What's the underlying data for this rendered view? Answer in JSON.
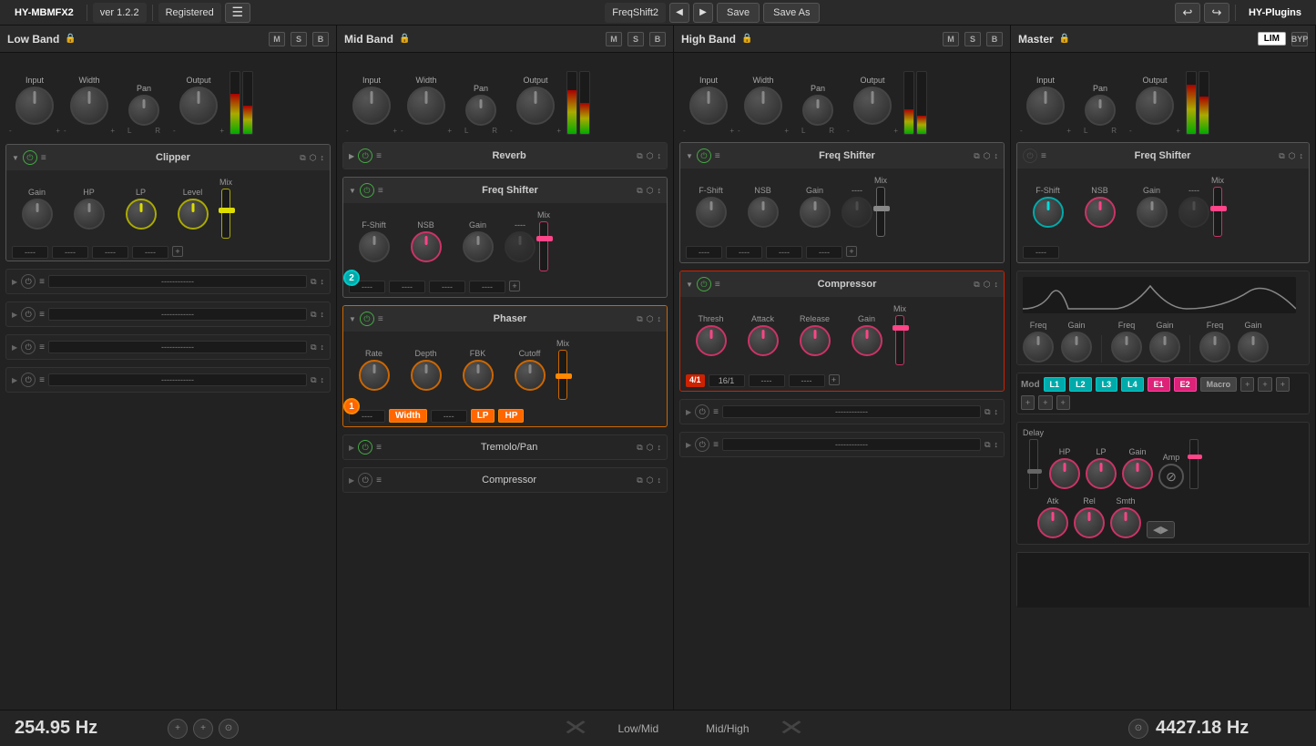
{
  "topbar": {
    "plugin_name": "HY-MBMFX2",
    "version": "ver 1.2.2",
    "registered": "Registered",
    "preset_name": "FreqShift2",
    "save_label": "Save",
    "save_as_label": "Save As",
    "brand": "HY-Plugins"
  },
  "bands": {
    "low": {
      "title": "Low Band",
      "m": "M",
      "s": "S",
      "b": "B",
      "knobs": [
        "Input",
        "Width",
        "Pan",
        "Output"
      ],
      "vu_levels": [
        65,
        45
      ]
    },
    "mid": {
      "title": "Mid Band",
      "m": "M",
      "s": "S",
      "b": "B",
      "knobs": [
        "Input",
        "Width",
        "Pan",
        "Output"
      ],
      "vu_levels": [
        70,
        50
      ]
    },
    "high": {
      "title": "High Band",
      "m": "M",
      "s": "S",
      "b": "B",
      "knobs": [
        "Input",
        "Width",
        "Pan",
        "Output"
      ],
      "vu_levels": [
        40,
        30
      ]
    },
    "master": {
      "title": "Master",
      "lim": "LIM",
      "byp": "BYP",
      "knobs": [
        "Input",
        "Pan",
        "Output"
      ],
      "vu_levels": [
        80,
        60
      ]
    }
  },
  "low_effects": {
    "slot1": {
      "name": "Clipper",
      "active": true
    },
    "slot2_label": "Gain",
    "slot2_hp": "HP",
    "slot2_lp": "LP",
    "slot2_level": "Level",
    "slot2_mix": "Mix",
    "empty1": "----",
    "empty2": "----",
    "empty3": "----",
    "empty4": "----"
  },
  "mid_effects": {
    "reverb": {
      "name": "Reverb",
      "active": true
    },
    "freq_shifter": {
      "name": "Freq Shifter",
      "params": [
        "F-Shift",
        "NSB",
        "Gain",
        "Mix"
      ],
      "badge": "2"
    },
    "phaser": {
      "name": "Phaser",
      "params": [
        "Rate",
        "Depth",
        "FBK",
        "Cutoff",
        "Mix"
      ],
      "badge": "1",
      "width_btn": "Width",
      "lp_btn": "LP",
      "hp_btn": "HP"
    },
    "tremolo": {
      "name": "Tremolo/Pan"
    },
    "compressor": {
      "name": "Compressor"
    }
  },
  "high_effects": {
    "freq_shifter": {
      "name": "Freq Shifter",
      "params": [
        "F-Shift",
        "NSB",
        "Gain",
        "Mix"
      ]
    },
    "compressor": {
      "name": "Compressor",
      "params": [
        "Thresh",
        "Attack",
        "Release",
        "Gain",
        "Mix"
      ],
      "ratio1": "4/1",
      "ratio2": "16/1"
    },
    "empty1": "----",
    "empty2": "----",
    "empty3": "----",
    "empty4": "----"
  },
  "master_effects": {
    "freq_shifter": {
      "name": "Freq Shifter",
      "params": [
        "F-Shift",
        "NSB",
        "Gain",
        "Mix"
      ]
    },
    "eq_section": {
      "freq1_label": "Freq",
      "gain1_label": "Gain",
      "freq2_label": "Freq",
      "gain2_label": "Gain",
      "freq3_label": "Freq",
      "gain3_label": "Gain"
    },
    "mod": {
      "label": "Mod",
      "buttons": [
        "L1",
        "L2",
        "L3",
        "L4",
        "E1",
        "E2",
        "Macro"
      ]
    },
    "envelope": {
      "delay_label": "Delay",
      "hp_label": "HP",
      "lp_label": "LP",
      "gain_label": "Gain",
      "amp_label": "Amp",
      "atk_label": "Atk",
      "rel_label": "Rel",
      "smth_label": "Smth"
    }
  },
  "bottom": {
    "freq_low": "254.95 Hz",
    "low_mid_label": "Low/Mid",
    "mid_high_label": "Mid/High",
    "freq_high": "4427.18 Hz"
  }
}
